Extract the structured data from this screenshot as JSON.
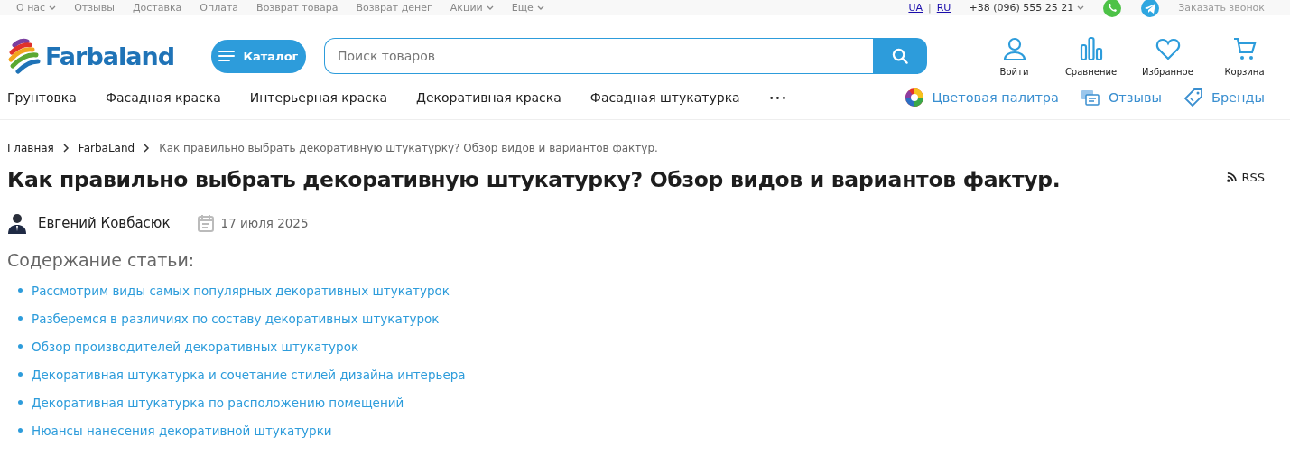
{
  "top_bar": {
    "links": [
      {
        "label": "О нас",
        "dropdown": true
      },
      {
        "label": "Отзывы",
        "dropdown": false
      },
      {
        "label": "Доставка",
        "dropdown": false
      },
      {
        "label": "Оплата",
        "dropdown": false
      },
      {
        "label": "Возврат товара",
        "dropdown": false
      },
      {
        "label": "Возврат денег",
        "dropdown": false
      },
      {
        "label": "Акции",
        "dropdown": true
      },
      {
        "label": "Еще",
        "dropdown": true
      }
    ],
    "languages": [
      "UA",
      "RU"
    ],
    "language_separator": "|",
    "phone": "+38 (096) 555 25 21",
    "callback": "Заказать звонок"
  },
  "header": {
    "logo": "Farbaland",
    "catalog_button": "Каталог",
    "search": {
      "placeholder": "Поиск товаров"
    },
    "actions": [
      {
        "kind": "user",
        "label": "Войти"
      },
      {
        "kind": "compare",
        "label": "Сравнение"
      },
      {
        "kind": "favorite",
        "label": "Избранное"
      },
      {
        "kind": "cart",
        "label": "Корзина"
      }
    ]
  },
  "nav": {
    "items": [
      "Грунтовка",
      "Фасадная краска",
      "Интерьерная краска",
      "Декоративная краска",
      "Фасадная штукатурка"
    ],
    "more": "•••",
    "extra_links": [
      {
        "kind": "palette",
        "label": "Цветовая палитра"
      },
      {
        "kind": "reviews",
        "label": "Отзывы"
      },
      {
        "kind": "brands",
        "label": "Бренды"
      }
    ]
  },
  "breadcrumbs": [
    "Главная",
    "FarbaLand",
    "Как правильно выбрать декоративную штукатурку? Обзор видов и вариантов фактур."
  ],
  "article": {
    "title": "Как правильно выбрать декоративную штукатурку? Обзор видов и вариантов фактур.",
    "rss": "RSS",
    "author": "Евгений Ковбасюк",
    "date": "17 июля 2025",
    "contents_title": "Содержание статьи:",
    "contents": [
      "Рассмотрим виды самых популярных декоративных штукатурок",
      "Разберемся в различиях по составу декоративных штукатурок",
      "Обзор производителей декоративных штукатурок",
      "Декоративная штукатурка и сочетание стилей дизайна интерьера",
      "Декоративная штукатурка по расположению помещений",
      "Нюансы нанесения декоративной штукатурки"
    ]
  }
}
